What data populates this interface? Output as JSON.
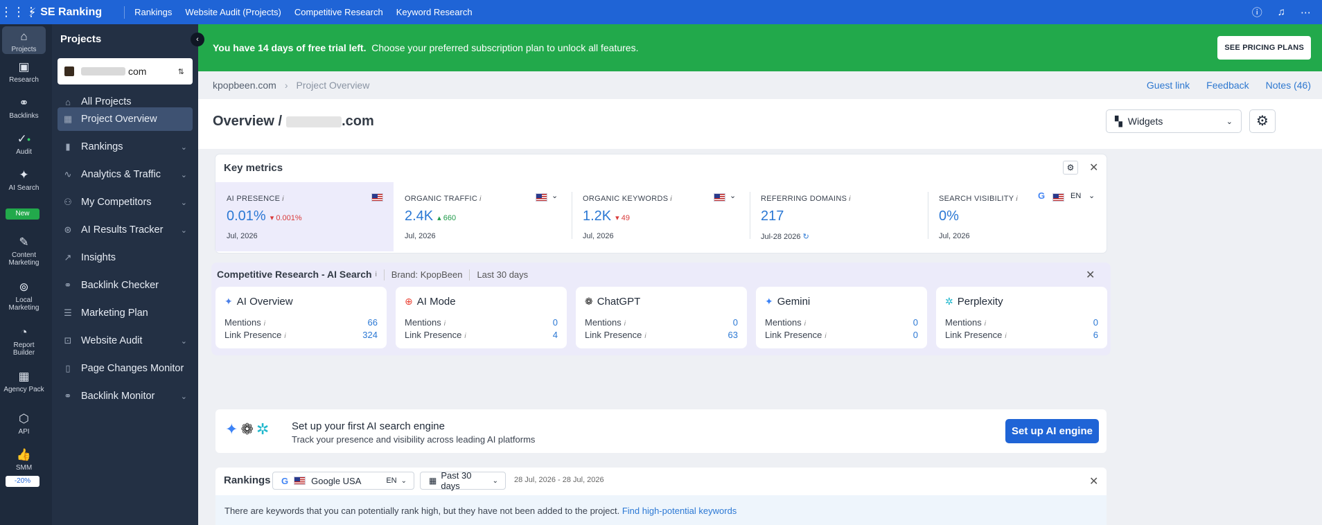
{
  "topbar": {
    "brand": "SE Ranking",
    "nav": [
      "Rankings",
      "Website Audit (Projects)",
      "Competitive Research",
      "Keyword Research"
    ]
  },
  "rail": {
    "items": [
      {
        "label": "Projects",
        "icon": "home-icon"
      },
      {
        "label": "Research",
        "icon": "research-icon"
      },
      {
        "label": "Backlinks",
        "icon": "link-icon"
      },
      {
        "label": "Audit",
        "icon": "check-circle-icon"
      },
      {
        "label": "AI Search",
        "icon": "sparkle-icon"
      },
      {
        "label": "Content Marketing",
        "icon": "edit-icon"
      },
      {
        "label": "Local Marketing",
        "icon": "map-pin-icon"
      },
      {
        "label": "Report Builder",
        "icon": "report-icon"
      },
      {
        "label": "Agency Pack",
        "icon": "building-icon"
      },
      {
        "label": "API",
        "icon": "api-icon"
      },
      {
        "label": "SMM",
        "icon": "thumbs-up-icon"
      }
    ],
    "ai_badge": "New",
    "smm_badge": "-20%"
  },
  "sidebar": {
    "title": "Projects",
    "project_suffix": "com",
    "items": [
      {
        "label": "All Projects",
        "chevron": false
      },
      {
        "label": "Project Overview",
        "chevron": false,
        "active": true
      },
      {
        "label": "Rankings",
        "chevron": true
      },
      {
        "label": "Analytics & Traffic",
        "chevron": true
      },
      {
        "label": "My Competitors",
        "chevron": true
      },
      {
        "label": "AI Results Tracker",
        "chevron": true
      },
      {
        "label": "Insights",
        "chevron": false
      },
      {
        "label": "Backlink Checker",
        "chevron": false
      },
      {
        "label": "Marketing Plan",
        "chevron": false
      },
      {
        "label": "Website Audit",
        "chevron": true
      },
      {
        "label": "Page Changes Monitor",
        "chevron": false
      },
      {
        "label": "Backlink Monitor",
        "chevron": true
      }
    ]
  },
  "trial": {
    "lead": "You have 14 days of free trial left.",
    "rest": "Choose your preferred subscription plan to unlock all features.",
    "button": "SEE PRICING PLANS"
  },
  "breadcrumb": {
    "root": "kpopbeen.com",
    "current": "Project Overview",
    "links": [
      "Guest link",
      "Feedback",
      "Notes (46)"
    ]
  },
  "header": {
    "title_prefix": "Overview /",
    "title_suffix": ".com",
    "widgets_label": "Widgets"
  },
  "key_metrics": {
    "title": "Key metrics",
    "metrics": [
      {
        "label": "AI PRESENCE",
        "value": "0.01%",
        "delta": "0.001%",
        "delta_dir": "down",
        "date": "Jul, 2026"
      },
      {
        "label": "ORGANIC TRAFFIC",
        "value": "2.4K",
        "delta": "660",
        "delta_dir": "up",
        "date": "Jul, 2026"
      },
      {
        "label": "ORGANIC KEYWORDS",
        "value": "1.2K",
        "delta": "49",
        "delta_dir": "down",
        "date": "Jul, 2026"
      },
      {
        "label": "REFERRING DOMAINS",
        "value": "217",
        "delta": "",
        "delta_dir": "",
        "date": "Jul-28 2026"
      },
      {
        "label": "SEARCH VISIBILITY",
        "value": "0%",
        "delta": "",
        "delta_dir": "",
        "date": "Jul, 2026",
        "lang": "EN"
      }
    ]
  },
  "competitive": {
    "title": "Competitive Research - AI Search",
    "brand": "Brand: KpopBeen",
    "period": "Last 30 days",
    "mentions_label": "Mentions",
    "link_presence_label": "Link Presence",
    "engines": [
      {
        "name": "AI Overview",
        "mentions": "66",
        "link_presence": "324"
      },
      {
        "name": "AI Mode",
        "mentions": "0",
        "link_presence": "4"
      },
      {
        "name": "ChatGPT",
        "mentions": "0",
        "link_presence": "63"
      },
      {
        "name": "Gemini",
        "mentions": "0",
        "link_presence": "0"
      },
      {
        "name": "Perplexity",
        "mentions": "0",
        "link_presence": "6"
      }
    ]
  },
  "setup": {
    "title": "Set up your first AI search engine",
    "subtitle": "Track your presence and visibility across leading AI platforms",
    "button": "Set up AI engine"
  },
  "rankings": {
    "title": "Rankings",
    "engine": "Google USA",
    "lang": "EN",
    "period": "Past 30 days",
    "range": "28 Jul, 2026 - 28 Jul, 2026",
    "note": "There are keywords that you can potentially rank high, but they have not been added to the project.",
    "note_link": "Find high-potential keywords"
  },
  "colors": {
    "brand_blue": "#1f64d6",
    "trial_green": "#22a94b",
    "value_blue": "#2b78d4",
    "down_red": "#d93a3a",
    "up_green": "#1f9a4a"
  }
}
